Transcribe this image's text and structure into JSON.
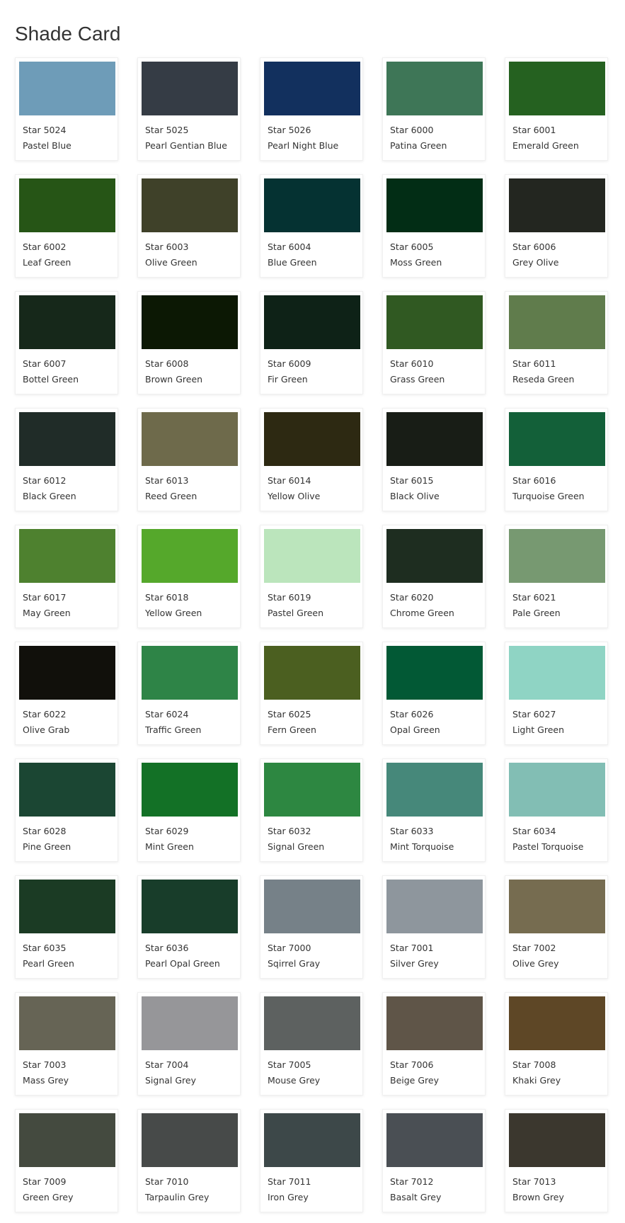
{
  "page": {
    "title": "Shade Card"
  },
  "shades": [
    {
      "code": "Star 5024",
      "name": "Pastel Blue",
      "color": "#6e9cb8"
    },
    {
      "code": "Star 5025",
      "name": "Pearl Gentian Blue",
      "color": "#353c45"
    },
    {
      "code": "Star 5026",
      "name": "Pearl Night Blue",
      "color": "#12305e"
    },
    {
      "code": "Star 6000",
      "name": "Patina Green",
      "color": "#3e7657"
    },
    {
      "code": "Star 6001",
      "name": "Emerald Green",
      "color": "#256120"
    },
    {
      "code": "Star 6002",
      "name": "Leaf Green",
      "color": "#265516"
    },
    {
      "code": "Star 6003",
      "name": "Olive Green",
      "color": "#3f4129"
    },
    {
      "code": "Star 6004",
      "name": "Blue Green",
      "color": "#053232"
    },
    {
      "code": "Star 6005",
      "name": "Moss Green",
      "color": "#022d15"
    },
    {
      "code": "Star 6006",
      "name": "Grey Olive",
      "color": "#232620"
    },
    {
      "code": "Star 6007",
      "name": "Bottel Green",
      "color": "#16281a"
    },
    {
      "code": "Star 6008",
      "name": "Brown Green",
      "color": "#0c1804"
    },
    {
      "code": "Star 6009",
      "name": "Fir Green",
      "color": "#0e2217"
    },
    {
      "code": "Star 6010",
      "name": "Grass Green",
      "color": "#305922"
    },
    {
      "code": "Star 6011",
      "name": "Reseda Green",
      "color": "#607c4c"
    },
    {
      "code": "Star 6012",
      "name": "Black Green",
      "color": "#202c28"
    },
    {
      "code": "Star 6013",
      "name": "Reed Green",
      "color": "#6e6a4b"
    },
    {
      "code": "Star 6014",
      "name": "Yellow Olive",
      "color": "#2d2912"
    },
    {
      "code": "Star 6015",
      "name": "Black Olive",
      "color": "#181d16"
    },
    {
      "code": "Star 6016",
      "name": "Turquoise Green",
      "color": "#136039"
    },
    {
      "code": "Star 6017",
      "name": "May Green",
      "color": "#4e812f"
    },
    {
      "code": "Star 6018",
      "name": "Yellow Green",
      "color": "#55a82b"
    },
    {
      "code": "Star 6019",
      "name": "Pastel Green",
      "color": "#bbe5bc"
    },
    {
      "code": "Star 6020",
      "name": "Chrome Green",
      "color": "#1e2d20"
    },
    {
      "code": "Star 6021",
      "name": "Pale Green",
      "color": "#779971"
    },
    {
      "code": "Star 6022",
      "name": "Olive Grab",
      "color": "#11100b"
    },
    {
      "code": "Star 6024",
      "name": "Traffic Green",
      "color": "#2e8447"
    },
    {
      "code": "Star 6025",
      "name": "Fern Green",
      "color": "#4b5f20"
    },
    {
      "code": "Star 6026",
      "name": "Opal Green",
      "color": "#025935"
    },
    {
      "code": "Star 6027",
      "name": "Light Green",
      "color": "#8fd4c4"
    },
    {
      "code": "Star 6028",
      "name": "Pine Green",
      "color": "#1b4633"
    },
    {
      "code": "Star 6029",
      "name": "Mint Green",
      "color": "#137126"
    },
    {
      "code": "Star 6032",
      "name": "Signal Green",
      "color": "#2d8741"
    },
    {
      "code": "Star 6033",
      "name": "Mint Torquoise",
      "color": "#46887a"
    },
    {
      "code": "Star 6034",
      "name": "Pastel Torquoise",
      "color": "#82beb4"
    },
    {
      "code": "Star 6035",
      "name": "Pearl Green",
      "color": "#1b3b24"
    },
    {
      "code": "Star 6036",
      "name": "Pearl Opal Green",
      "color": "#183d2a"
    },
    {
      "code": "Star 7000",
      "name": "Sqirrel Gray",
      "color": "#768188"
    },
    {
      "code": "Star 7001",
      "name": "Silver Grey",
      "color": "#8e969d"
    },
    {
      "code": "Star 7002",
      "name": "Olive Grey",
      "color": "#766c50"
    },
    {
      "code": "Star 7003",
      "name": "Mass Grey",
      "color": "#666455"
    },
    {
      "code": "Star 7004",
      "name": "Signal Grey",
      "color": "#969699"
    },
    {
      "code": "Star 7005",
      "name": "Mouse Grey",
      "color": "#5d6160"
    },
    {
      "code": "Star 7006",
      "name": "Beige Grey",
      "color": "#5f5548"
    },
    {
      "code": "Star 7008",
      "name": "Khaki Grey",
      "color": "#5e4726"
    },
    {
      "code": "Star 7009",
      "name": "Green Grey",
      "color": "#444a3f"
    },
    {
      "code": "Star 7010",
      "name": "Tarpaulin Grey",
      "color": "#474a49"
    },
    {
      "code": "Star 7011",
      "name": "Iron Grey",
      "color": "#3d4849"
    },
    {
      "code": "Star 7012",
      "name": "Basalt Grey",
      "color": "#4a4f54"
    },
    {
      "code": "Star 7013",
      "name": "Brown Grey",
      "color": "#3b372e"
    }
  ]
}
